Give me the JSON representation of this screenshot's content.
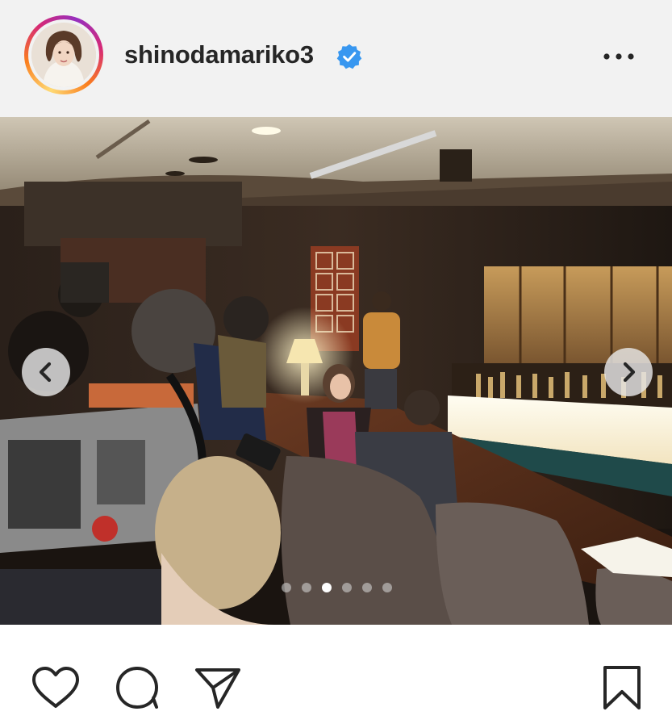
{
  "post": {
    "username": "shinodamariko3",
    "verified": true,
    "avatar_alt": "profile photo",
    "more_icon": "more-horizontal-icon",
    "carousel": {
      "total_slides": 6,
      "active_slide": 3,
      "prev_icon": "chevron-left-icon",
      "next_icon": "chevron-right-icon"
    },
    "actions": {
      "like_icon": "heart-icon",
      "comment_icon": "comment-bubble-icon",
      "share_icon": "paper-plane-icon",
      "save_icon": "bookmark-icon"
    }
  },
  "colors": {
    "header_bg": "#f2f2f2",
    "text": "#262626",
    "verified": "#3897f0",
    "ring_gradient": [
      "#feda75",
      "#fa7e1e",
      "#d62976",
      "#962fbf"
    ]
  }
}
